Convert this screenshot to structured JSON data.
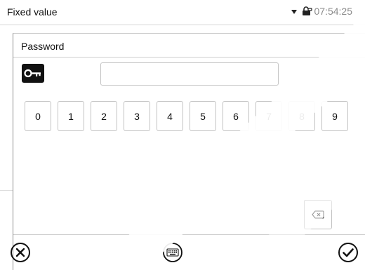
{
  "header": {
    "title": "Fixed value",
    "time": "07:54:25"
  },
  "dialog": {
    "title": "Password",
    "password_value": "",
    "digits": [
      "0",
      "1",
      "2",
      "3",
      "4",
      "5",
      "6",
      "7",
      "8",
      "9"
    ]
  },
  "icons": {
    "dropdown": "triangle-down-icon",
    "lock": "lock-icon",
    "key": "key-icon",
    "backspace": "backspace-icon",
    "cancel": "close-circle-icon",
    "keyboard": "keyboard-icon",
    "confirm": "check-circle-icon"
  },
  "colors": {
    "time_text": "#8a8a8a",
    "watermark": "#ffffff"
  }
}
